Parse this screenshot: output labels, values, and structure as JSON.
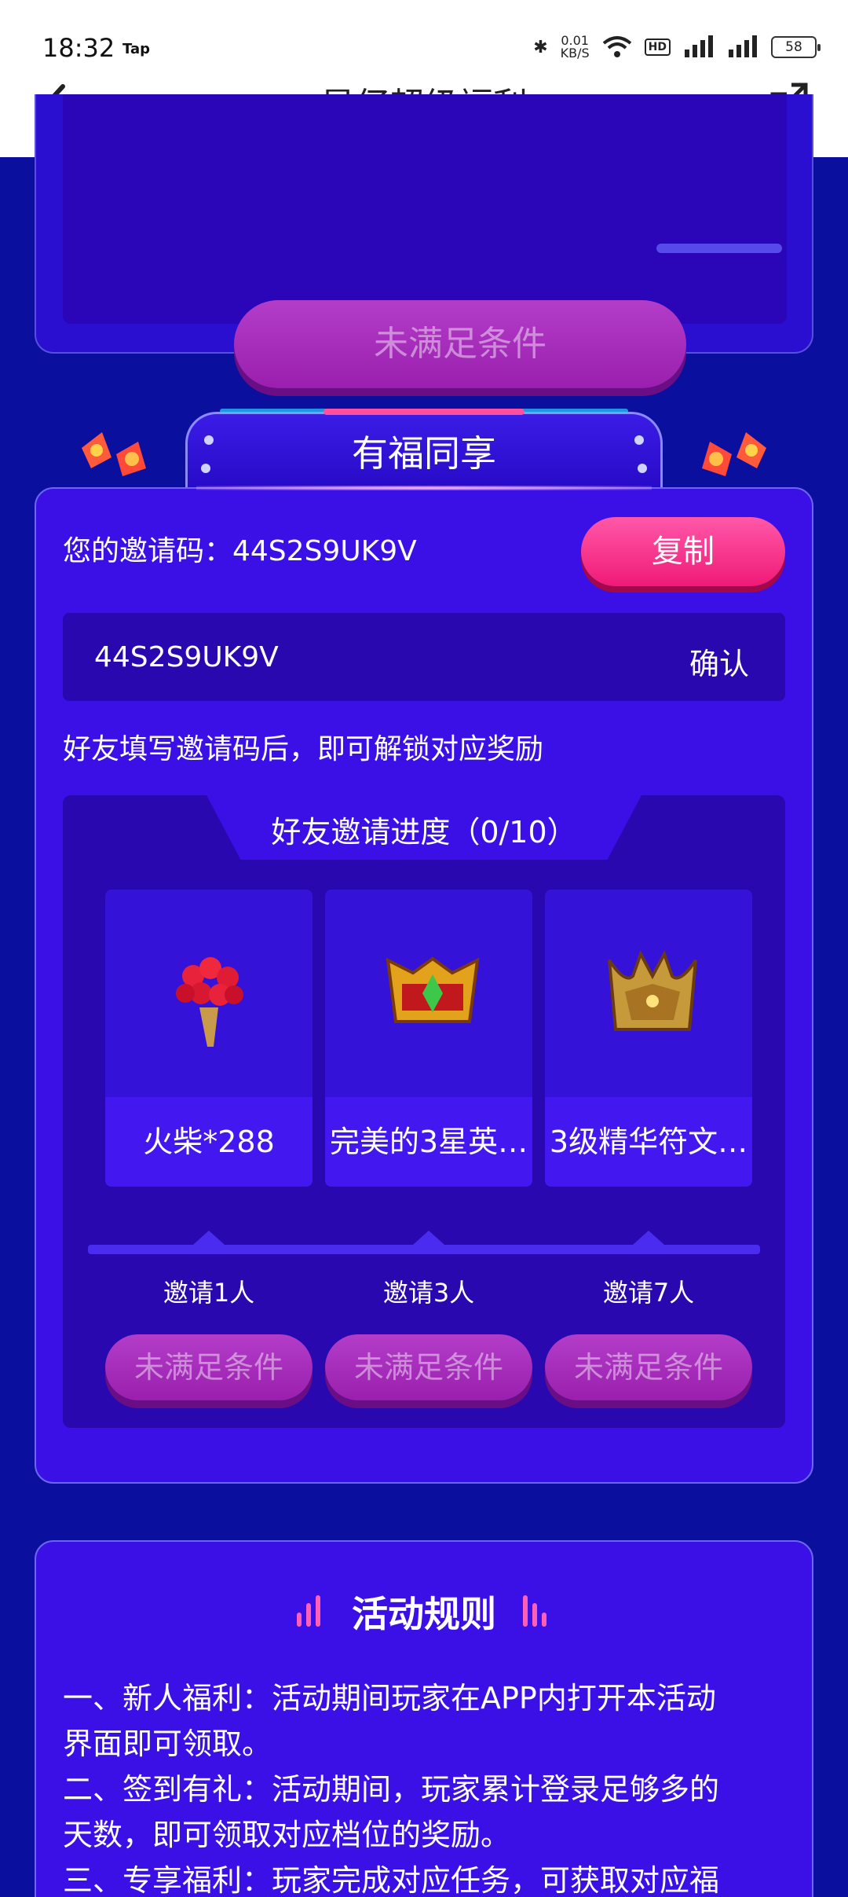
{
  "status_bar": {
    "time": "18:32",
    "app_tag": "Tap",
    "net_speed": "0.01",
    "net_unit": "KB/S",
    "battery": "58"
  },
  "header": {
    "title": "星仔超级福利"
  },
  "top_card": {
    "button_label": "未满足条件"
  },
  "share_section": {
    "ribbon_title": "有福同享",
    "invite_code_label": "您的邀请码：44S2S9UK9V",
    "copy_button": "复制",
    "input_value": "44S2S9UK9V",
    "confirm_button": "确认",
    "hint": "好友填写邀请码后，即可解锁对应奖励",
    "progress_title": "好友邀请进度（0/10）",
    "rewards": [
      {
        "name": "火柴*288",
        "icon": "flower-bouquet-icon",
        "requirement": "邀请1人",
        "button": "未满足条件"
      },
      {
        "name": "完美的3星英…",
        "icon": "gold-crest-icon",
        "requirement": "邀请3人",
        "button": "未满足条件"
      },
      {
        "name": "3级精华符文…",
        "icon": "golden-crown-icon",
        "requirement": "邀请7人",
        "button": "未满足条件"
      }
    ]
  },
  "rules": {
    "title": "活动规则",
    "lines": [
      "一、新人福利：活动期间玩家在APP内打开本活动",
      "界面即可领取。",
      "二、签到有礼：活动期间，玩家累计登录足够多的",
      "天数，即可领取对应档位的奖励。",
      "三、专享福利：玩家完成对应任务，可获取对应福"
    ]
  },
  "colors": {
    "background": "#0b0f9e",
    "card": "#3a10e6",
    "accent_pink": "#f01a78",
    "disabled_button": "#9a1fae"
  }
}
